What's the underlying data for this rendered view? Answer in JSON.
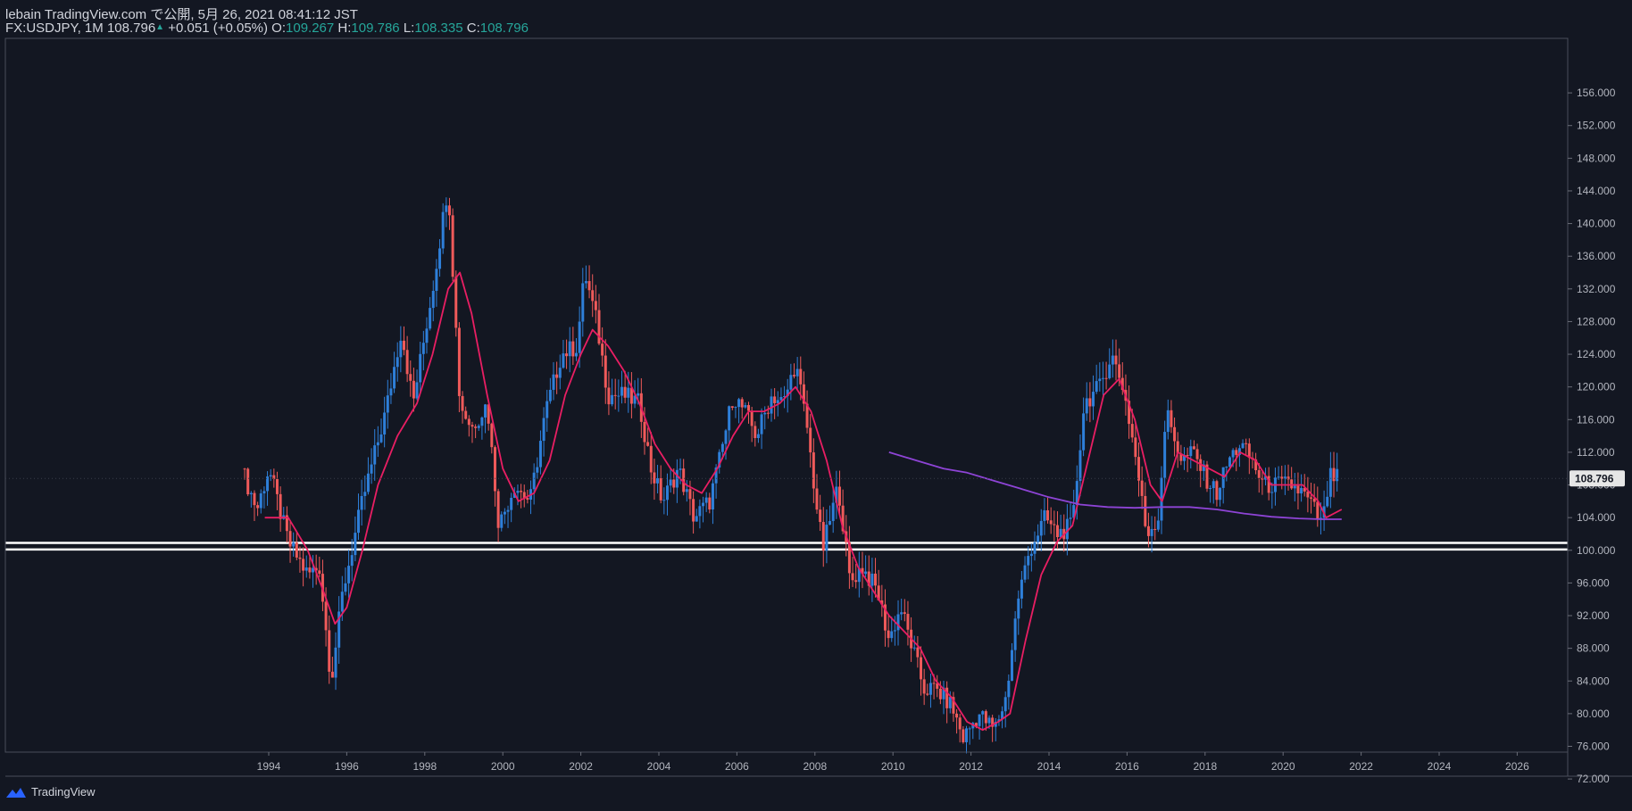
{
  "header": {
    "publish_line": "lebain TradingView.com で公開, 5月 26, 2021 08:41:12 JST",
    "symbol": "FX:USDJPY, 1M",
    "last": "108.796",
    "change": "+0.051 (+0.05%)",
    "o_label": "O:",
    "o": "109.267",
    "h_label": "H:",
    "h": "109.786",
    "l_label": "L:",
    "l": "108.335",
    "c_label": "C:",
    "c": "108.796"
  },
  "footer": {
    "brand": "TradingView",
    "logo_icon": "tradingview-logo-icon"
  },
  "colors": {
    "background": "#131722",
    "up": "#2e7fd9",
    "down": "#ef5a5a",
    "ma_short": "#e91e63",
    "ma_long": "#8e44d6",
    "axis_text": "#b2b5be",
    "support": "#ffffff"
  },
  "chart_data": {
    "type": "candlestick",
    "symbol": "FX:USDJPY",
    "interval": "1M",
    "last_price_label": "108.796",
    "ylim": [
      68,
      157
    ],
    "y_ticks": [
      "156.000",
      "152.000",
      "148.000",
      "144.000",
      "140.000",
      "136.000",
      "132.000",
      "128.000",
      "124.000",
      "120.000",
      "116.000",
      "112.000",
      "108.000",
      "104.000",
      "100.000",
      "96.000",
      "92.000",
      "88.000",
      "84.000",
      "80.000",
      "76.000",
      "72.000"
    ],
    "x_ticks": [
      "1994",
      "1996",
      "1998",
      "2000",
      "2002",
      "2004",
      "2006",
      "2008",
      "2010",
      "2012",
      "2014",
      "2016",
      "2018",
      "2020",
      "2022",
      "2024",
      "2026"
    ],
    "support_band": [
      100.1,
      100.9
    ],
    "price_path": [
      [
        1993.3,
        110
      ],
      [
        1993.7,
        105
      ],
      [
        1994.0,
        110
      ],
      [
        1994.5,
        101
      ],
      [
        1995.0,
        97
      ],
      [
        1995.3,
        98
      ],
      [
        1995.6,
        84
      ],
      [
        1995.9,
        95
      ],
      [
        1996.4,
        106
      ],
      [
        1997.0,
        117
      ],
      [
        1997.4,
        127
      ],
      [
        1997.7,
        118
      ],
      [
        1998.2,
        132
      ],
      [
        1998.6,
        145
      ],
      [
        1998.9,
        118
      ],
      [
        1999.2,
        115
      ],
      [
        1999.6,
        118
      ],
      [
        1999.9,
        103
      ],
      [
        2000.3,
        108
      ],
      [
        2000.7,
        106
      ],
      [
        2001.1,
        117
      ],
      [
        2001.5,
        124
      ],
      [
        2001.9,
        125
      ],
      [
        2002.1,
        134
      ],
      [
        2002.4,
        128
      ],
      [
        2002.7,
        119
      ],
      [
        2003.1,
        119
      ],
      [
        2003.5,
        118
      ],
      [
        2003.8,
        110
      ],
      [
        2004.1,
        106
      ],
      [
        2004.5,
        110
      ],
      [
        2004.9,
        104
      ],
      [
        2005.3,
        106
      ],
      [
        2005.6,
        112
      ],
      [
        2005.9,
        119
      ],
      [
        2006.2,
        117
      ],
      [
        2006.5,
        114
      ],
      [
        2006.9,
        119
      ],
      [
        2007.2,
        118
      ],
      [
        2007.5,
        123
      ],
      [
        2007.8,
        115
      ],
      [
        2008.0,
        107
      ],
      [
        2008.2,
        100
      ],
      [
        2008.6,
        108
      ],
      [
        2008.9,
        96
      ],
      [
        2009.2,
        98
      ],
      [
        2009.6,
        95
      ],
      [
        2009.9,
        89
      ],
      [
        2010.2,
        93
      ],
      [
        2010.5,
        88
      ],
      [
        2010.8,
        83
      ],
      [
        2011.1,
        83
      ],
      [
        2011.5,
        81
      ],
      [
        2011.8,
        77
      ],
      [
        2012.2,
        80
      ],
      [
        2012.6,
        78
      ],
      [
        2012.9,
        82
      ],
      [
        2013.2,
        94
      ],
      [
        2013.5,
        100
      ],
      [
        2013.9,
        104
      ],
      [
        2014.2,
        102
      ],
      [
        2014.6,
        103
      ],
      [
        2014.9,
        118
      ],
      [
        2015.3,
        120
      ],
      [
        2015.6,
        124
      ],
      [
        2015.9,
        120
      ],
      [
        2016.2,
        112
      ],
      [
        2016.5,
        102
      ],
      [
        2016.8,
        104
      ],
      [
        2017.0,
        117
      ],
      [
        2017.4,
        111
      ],
      [
        2017.7,
        112
      ],
      [
        2018.0,
        109
      ],
      [
        2018.3,
        107
      ],
      [
        2018.6,
        111
      ],
      [
        2018.9,
        113
      ],
      [
        2019.2,
        111
      ],
      [
        2019.5,
        108
      ],
      [
        2019.8,
        108
      ],
      [
        2020.2,
        108
      ],
      [
        2020.5,
        107
      ],
      [
        2020.8,
        105
      ],
      [
        2021.0,
        103
      ],
      [
        2021.2,
        109
      ],
      [
        2021.38,
        108.8
      ]
    ],
    "ma_short": [
      [
        1993.9,
        104
      ],
      [
        1994.5,
        104
      ],
      [
        1995.0,
        100
      ],
      [
        1995.4,
        95
      ],
      [
        1995.7,
        91
      ],
      [
        1996.0,
        93
      ],
      [
        1996.4,
        100
      ],
      [
        1996.8,
        108
      ],
      [
        1997.3,
        114
      ],
      [
        1997.8,
        118
      ],
      [
        1998.2,
        124
      ],
      [
        1998.6,
        132
      ],
      [
        1998.9,
        134
      ],
      [
        1999.2,
        129
      ],
      [
        1999.6,
        119
      ],
      [
        2000.0,
        110
      ],
      [
        2000.4,
        106
      ],
      [
        2000.8,
        107
      ],
      [
        2001.2,
        111
      ],
      [
        2001.6,
        119
      ],
      [
        2002.0,
        124
      ],
      [
        2002.3,
        127
      ],
      [
        2002.7,
        125
      ],
      [
        2003.1,
        122
      ],
      [
        2003.5,
        118
      ],
      [
        2003.9,
        113
      ],
      [
        2004.3,
        110
      ],
      [
        2004.7,
        108
      ],
      [
        2005.1,
        107
      ],
      [
        2005.5,
        110
      ],
      [
        2005.9,
        114
      ],
      [
        2006.3,
        117
      ],
      [
        2006.7,
        117
      ],
      [
        2007.1,
        118
      ],
      [
        2007.5,
        120
      ],
      [
        2007.9,
        117
      ],
      [
        2008.3,
        111
      ],
      [
        2008.7,
        103
      ],
      [
        2009.1,
        98
      ],
      [
        2009.5,
        95
      ],
      [
        2009.9,
        92
      ],
      [
        2010.3,
        90
      ],
      [
        2010.7,
        88
      ],
      [
        2011.1,
        84
      ],
      [
        2011.5,
        82
      ],
      [
        2011.9,
        79
      ],
      [
        2012.3,
        78
      ],
      [
        2012.7,
        79
      ],
      [
        2013.0,
        80
      ],
      [
        2013.4,
        89
      ],
      [
        2013.8,
        97
      ],
      [
        2014.2,
        101
      ],
      [
        2014.6,
        103
      ],
      [
        2015.0,
        111
      ],
      [
        2015.4,
        119
      ],
      [
        2015.8,
        121
      ],
      [
        2016.2,
        116
      ],
      [
        2016.6,
        108
      ],
      [
        2016.9,
        106
      ],
      [
        2017.3,
        112
      ],
      [
        2017.7,
        111
      ],
      [
        2018.1,
        110
      ],
      [
        2018.5,
        109
      ],
      [
        2018.9,
        112
      ],
      [
        2019.3,
        111
      ],
      [
        2019.7,
        108
      ],
      [
        2020.1,
        108
      ],
      [
        2020.5,
        108
      ],
      [
        2020.9,
        106
      ],
      [
        2021.1,
        104
      ],
      [
        2021.5,
        105
      ]
    ],
    "ma_long": [
      [
        2009.9,
        112
      ],
      [
        2010.6,
        111
      ],
      [
        2011.3,
        110
      ],
      [
        2011.9,
        109.5
      ],
      [
        2012.6,
        108.5
      ],
      [
        2013.3,
        107.5
      ],
      [
        2014.0,
        106.5
      ],
      [
        2014.8,
        105.6
      ],
      [
        2015.5,
        105.3
      ],
      [
        2016.2,
        105.2
      ],
      [
        2016.9,
        105.3
      ],
      [
        2017.6,
        105.3
      ],
      [
        2018.3,
        105.0
      ],
      [
        2019.0,
        104.5
      ],
      [
        2019.7,
        104.1
      ],
      [
        2020.4,
        103.9
      ],
      [
        2021.0,
        103.8
      ],
      [
        2021.5,
        103.8
      ]
    ]
  }
}
